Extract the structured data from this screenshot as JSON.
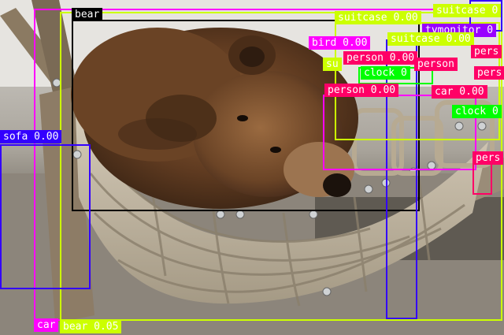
{
  "colors": {
    "magenta": "#ff00ff",
    "yellowgreen": "#ccff00",
    "blue": "#3300ff",
    "black": "#000000",
    "crimson": "#ff0066",
    "green": "#00ff00",
    "violet": "#9900ff",
    "white": "#ffffff"
  },
  "detections": [
    {
      "label": "bear"
    },
    {
      "label": "suitcase 0.00"
    },
    {
      "label": "suitcase 0"
    },
    {
      "label": "tvmonitor 0"
    },
    {
      "label": "suitcase 0.00"
    },
    {
      "label": "bird 0.00"
    },
    {
      "label": "person 0.00"
    },
    {
      "label": "person"
    },
    {
      "label": "person 0.00"
    },
    {
      "label": "pers"
    },
    {
      "label": "su"
    },
    {
      "label": "clock 0"
    },
    {
      "label": "car 0.00"
    },
    {
      "label": "clock 0"
    },
    {
      "label": "pers"
    },
    {
      "label": "sofa 0.00"
    },
    {
      "label": "car"
    },
    {
      "label": "bear 0.05"
    }
  ]
}
